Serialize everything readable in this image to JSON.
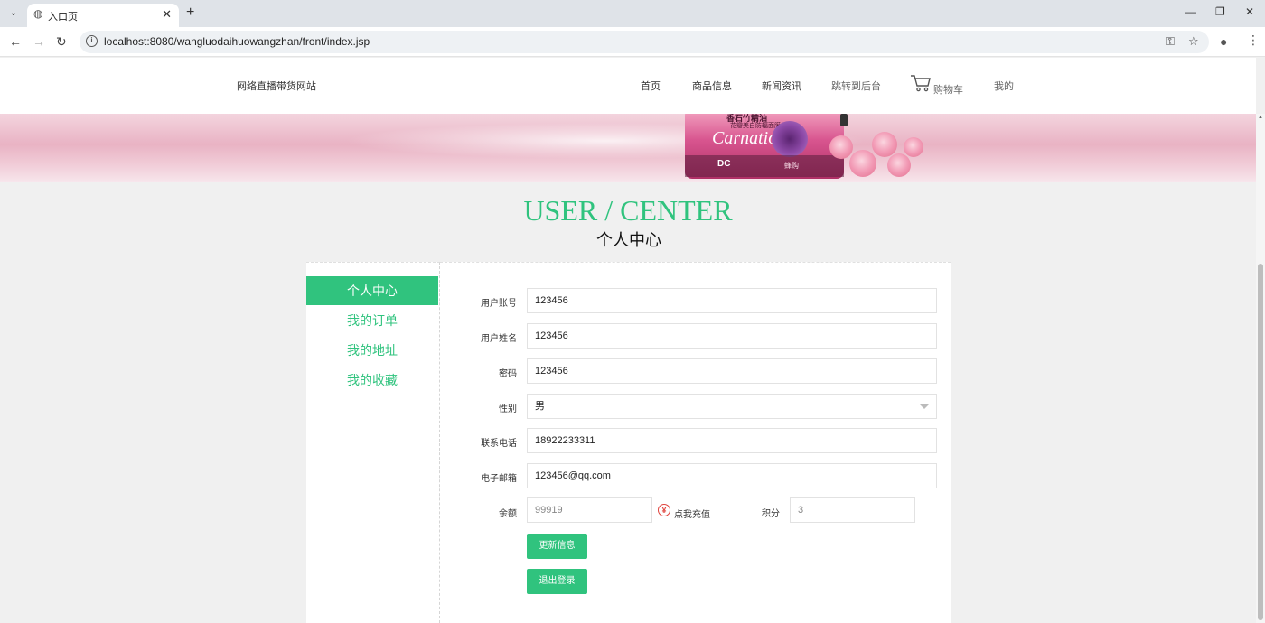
{
  "browser": {
    "tab_title": "入口页",
    "url": "localhost:8080/wangluodaihuowangzhan/front/index.jsp"
  },
  "header": {
    "site_name": "网络直播带货网站",
    "nav": [
      "首页",
      "商品信息",
      "新闻资讯",
      "跳转到后台",
      "购物车",
      "我的"
    ]
  },
  "banner": {
    "product_label": "香石竹精油",
    "product_sub": "花瓣美白防辐面膜",
    "product_brand": "Carnation",
    "product_mark": "DC",
    "product_mark_text": "蜂购"
  },
  "page": {
    "title": "USER / CENTER",
    "subtitle": "个人中心"
  },
  "sidebar": {
    "items": [
      "个人中心",
      "我的订单",
      "我的地址",
      "我的收藏"
    ],
    "active_index": 0
  },
  "form": {
    "account_label": "用户账号",
    "account_value": "123456",
    "name_label": "用户姓名",
    "name_value": "123456",
    "password_label": "密码",
    "password_value": "123456",
    "gender_label": "性别",
    "gender_value": "男",
    "phone_label": "联系电话",
    "phone_value": "18922233311",
    "email_label": "电子邮箱",
    "email_value": "123456@qq.com",
    "balance_label": "余额",
    "balance_value": "99919",
    "recharge_label": "点我充值",
    "points_label": "积分",
    "points_value": "3",
    "update_button": "更新信息",
    "logout_button": "退出登录"
  },
  "colors": {
    "accent": "#30c37e",
    "recharge": "#e0443e"
  }
}
